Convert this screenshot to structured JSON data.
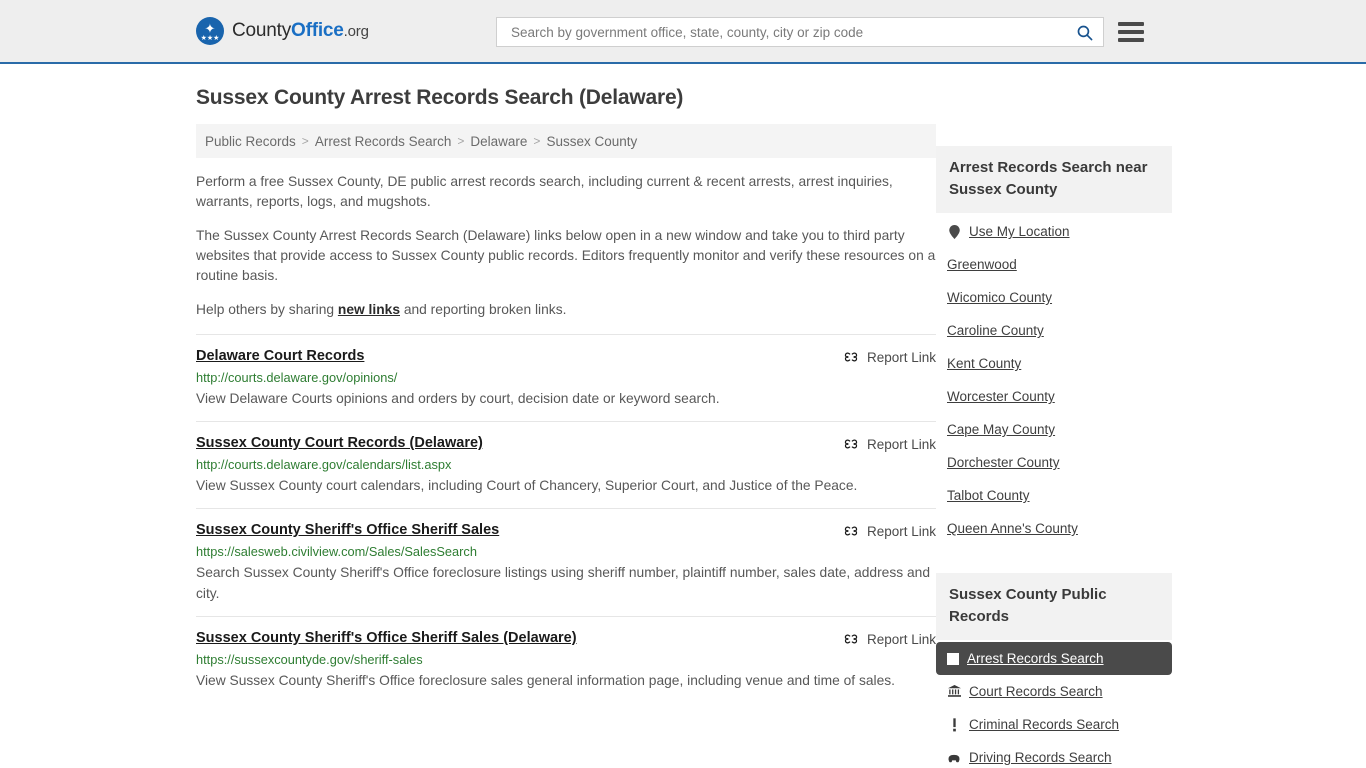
{
  "header": {
    "logo": {
      "county": "County",
      "office": "Office",
      "org": ".org",
      "eagle_glyph": "✦",
      "stars_glyph": "★★★"
    },
    "search": {
      "placeholder": "Search by government office, state, county, city or zip code",
      "value": "",
      "search_icon": "search-icon"
    },
    "menu_icon": "hamburger-menu-icon"
  },
  "main": {
    "title": "Sussex County Arrest Records Search (Delaware)",
    "breadcrumb": [
      "Public Records",
      "Arrest Records Search",
      "Delaware",
      "Sussex County"
    ],
    "breadcrumb_separator": ">",
    "intro_1": "Perform a free Sussex County, DE public arrest records search, including current & recent arrests, arrest inquiries, warrants, reports, logs, and mugshots.",
    "intro_2": "The Sussex County Arrest Records Search (Delaware) links below open in a new window and take you to third party websites that provide access to Sussex County public records. Editors frequently monitor and verify these resources on a routine basis.",
    "intro_3_before": "Help others by sharing ",
    "intro_3_link": "new links",
    "intro_3_after": " and reporting broken links.",
    "report_link_label": "Report Link",
    "report_link_icon": "broken-link-icon",
    "results": [
      {
        "title": "Delaware Court Records",
        "url": "http://courts.delaware.gov/opinions/",
        "description": "View Delaware Courts opinions and orders by court, decision date or keyword search."
      },
      {
        "title": "Sussex County Court Records (Delaware)",
        "url": "http://courts.delaware.gov/calendars/list.aspx",
        "description": "View Sussex County court calendars, including Court of Chancery, Superior Court, and Justice of the Peace."
      },
      {
        "title": "Sussex County Sheriff's Office Sheriff Sales",
        "url": "https://salesweb.civilview.com/Sales/SalesSearch",
        "description": "Search Sussex County Sheriff's Office foreclosure listings using sheriff number, plaintiff number, sales date, address and city."
      },
      {
        "title": "Sussex County Sheriff's Office Sheriff Sales (Delaware)",
        "url": "https://sussexcountyde.gov/sheriff-sales",
        "description": "View Sussex County Sheriff's Office foreclosure sales general information page, including venue and time of sales."
      }
    ]
  },
  "sidebar": {
    "nearby": {
      "heading": "Arrest Records Search near Sussex County",
      "items": [
        {
          "label": "Use My Location",
          "icon": "location-pin-icon"
        },
        {
          "label": "Greenwood",
          "icon": ""
        },
        {
          "label": "Wicomico County",
          "icon": ""
        },
        {
          "label": "Caroline County",
          "icon": ""
        },
        {
          "label": "Kent County",
          "icon": ""
        },
        {
          "label": "Worcester County",
          "icon": ""
        },
        {
          "label": "Cape May County",
          "icon": ""
        },
        {
          "label": "Dorchester County",
          "icon": ""
        },
        {
          "label": "Talbot County",
          "icon": ""
        },
        {
          "label": "Queen Anne's County",
          "icon": ""
        }
      ]
    },
    "public_records": {
      "heading": "Sussex County Public Records",
      "items": [
        {
          "label": "Arrest Records Search",
          "icon": "white-square-icon",
          "active": true
        },
        {
          "label": "Court Records Search",
          "icon": "bank-icon",
          "glyph": "ἽB",
          "active": false
        },
        {
          "label": "Criminal Records Search",
          "icon": "exclamation-icon",
          "glyph": "!",
          "active": false
        },
        {
          "label": "Driving Records Search",
          "icon": "car-icon",
          "glyph": "Ὡ7",
          "active": false
        }
      ]
    }
  },
  "colors": {
    "header_bg": "#eeeeee",
    "header_border": "#2a6ba8",
    "brand_blue": "#1a6fc4",
    "url_green": "#2e7d32",
    "active_bg": "#4a4a4a",
    "panel_bg": "#f2f2f2",
    "breadcrumb_bg": "#f4f4f4"
  }
}
